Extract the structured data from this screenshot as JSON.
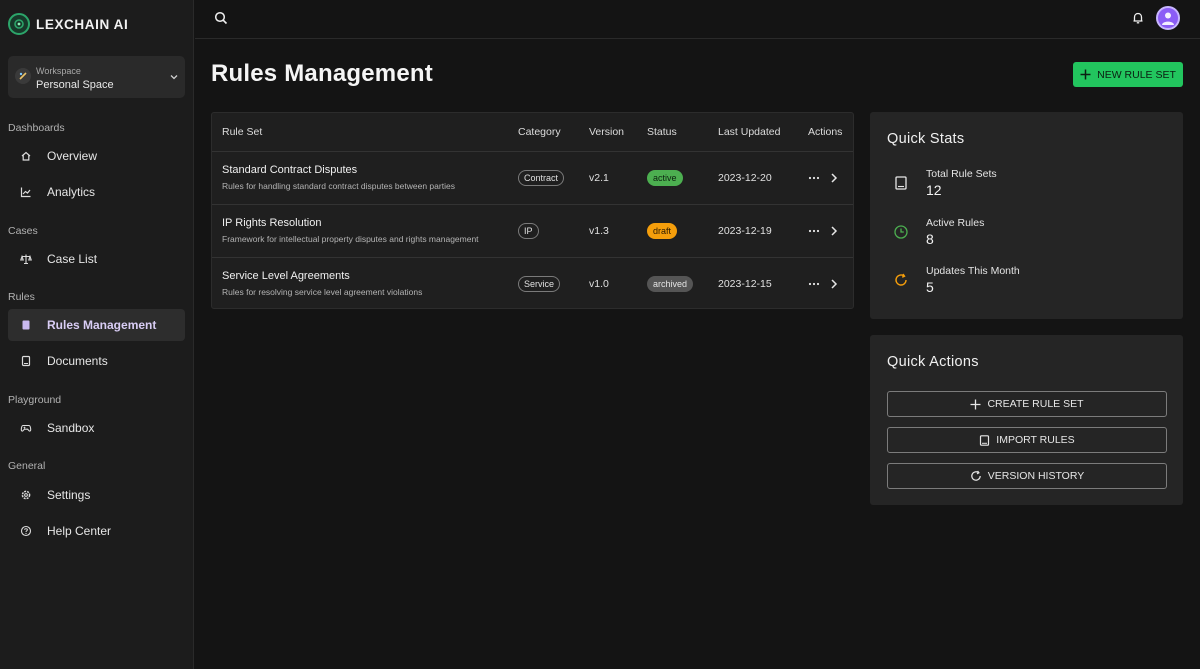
{
  "app": {
    "name": "LEXCHAIN AI"
  },
  "workspace": {
    "label": "Workspace",
    "name": "Personal Space"
  },
  "sidebar": {
    "sections": [
      {
        "title": "Dashboards",
        "items": [
          {
            "label": "Overview",
            "icon": "home-icon"
          },
          {
            "label": "Analytics",
            "icon": "chart-icon"
          }
        ]
      },
      {
        "title": "Cases",
        "items": [
          {
            "label": "Case List",
            "icon": "scale-icon"
          }
        ]
      },
      {
        "title": "Rules",
        "items": [
          {
            "label": "Rules Management",
            "icon": "book-icon",
            "active": true
          },
          {
            "label": "Documents",
            "icon": "document-icon"
          }
        ]
      },
      {
        "title": "Playground",
        "items": [
          {
            "label": "Sandbox",
            "icon": "gamepad-icon"
          }
        ]
      },
      {
        "title": "General",
        "items": [
          {
            "label": "Settings",
            "icon": "gear-icon"
          },
          {
            "label": "Help Center",
            "icon": "help-icon"
          }
        ]
      }
    ]
  },
  "header": {
    "title": "Rules Management",
    "new_button": "NEW RULE SET"
  },
  "table": {
    "columns": [
      "Rule Set",
      "Category",
      "Version",
      "Status",
      "Last Updated",
      "Actions"
    ],
    "rows": [
      {
        "name": "Standard Contract Disputes",
        "description": "Rules for handling standard contract disputes between parties",
        "category": "Contract",
        "version": "v2.1",
        "status": "active",
        "updated": "2023-12-20"
      },
      {
        "name": "IP Rights Resolution",
        "description": "Framework for intellectual property disputes and rights management",
        "category": "IP",
        "version": "v1.3",
        "status": "draft",
        "updated": "2023-12-19"
      },
      {
        "name": "Service Level Agreements",
        "description": "Rules for resolving service level agreement violations",
        "category": "Service",
        "version": "v1.0",
        "status": "archived",
        "updated": "2023-12-15"
      }
    ]
  },
  "status_colors": {
    "active": "#4caf50",
    "draft": "#f59e0b",
    "archived": "#555555"
  },
  "quick_stats": {
    "title": "Quick Stats",
    "items": [
      {
        "label": "Total Rule Sets",
        "value": "12",
        "icon": "book-icon"
      },
      {
        "label": "Active Rules",
        "value": "8",
        "icon": "clock-icon"
      },
      {
        "label": "Updates This Month",
        "value": "5",
        "icon": "refresh-icon"
      }
    ]
  },
  "quick_actions": {
    "title": "Quick Actions",
    "buttons": [
      {
        "label": "CREATE RULE SET",
        "icon": "plus-icon"
      },
      {
        "label": "IMPORT RULES",
        "icon": "book-icon"
      },
      {
        "label": "VERSION HISTORY",
        "icon": "refresh-icon"
      }
    ]
  },
  "colors": {
    "accent": "#22c55e",
    "active_nav": "#d9cdf5",
    "avatar": "#8b5cf6"
  }
}
